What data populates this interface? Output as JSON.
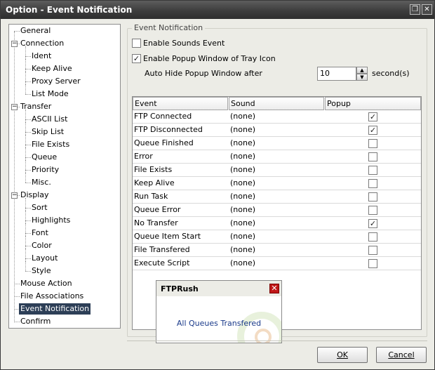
{
  "window": {
    "title": "Option - Event Notification"
  },
  "tree": [
    {
      "label": "General",
      "level": 0
    },
    {
      "label": "Connection",
      "level": 0,
      "expander": "−"
    },
    {
      "label": "Ident",
      "level": 1
    },
    {
      "label": "Keep Alive",
      "level": 1
    },
    {
      "label": "Proxy Server",
      "level": 1
    },
    {
      "label": "List Mode",
      "level": 1
    },
    {
      "label": "Transfer",
      "level": 0,
      "expander": "−"
    },
    {
      "label": "ASCII List",
      "level": 1
    },
    {
      "label": "Skip List",
      "level": 1
    },
    {
      "label": "File Exists",
      "level": 1
    },
    {
      "label": "Queue",
      "level": 1
    },
    {
      "label": "Priority",
      "level": 1
    },
    {
      "label": "Misc.",
      "level": 1
    },
    {
      "label": "Display",
      "level": 0,
      "expander": "−"
    },
    {
      "label": "Sort",
      "level": 1
    },
    {
      "label": "Highlights",
      "level": 1
    },
    {
      "label": "Font",
      "level": 1
    },
    {
      "label": "Color",
      "level": 1
    },
    {
      "label": "Layout",
      "level": 1
    },
    {
      "label": "Style",
      "level": 1
    },
    {
      "label": "Mouse Action",
      "level": 0
    },
    {
      "label": "File Associations",
      "level": 0
    },
    {
      "label": "Event Notification",
      "level": 0,
      "selected": true
    },
    {
      "label": "Confirm",
      "level": 0
    }
  ],
  "group": {
    "legend": "Event Notification"
  },
  "options": {
    "sounds": {
      "label": "Enable Sounds Event",
      "checked": false
    },
    "popup": {
      "label": "Enable Popup Window of Tray Icon",
      "checked": true
    },
    "autohide_label": "Auto Hide Popup Window after",
    "autohide_value": "10",
    "autohide_unit": "second(s)"
  },
  "table": {
    "columns": [
      "Event",
      "Sound",
      "Popup"
    ],
    "rows": [
      {
        "event": "FTP Connected",
        "sound": "(none)",
        "popup": true
      },
      {
        "event": "FTP Disconnected",
        "sound": "(none)",
        "popup": true
      },
      {
        "event": "Queue Finished",
        "sound": "(none)",
        "popup": false
      },
      {
        "event": "Error",
        "sound": "(none)",
        "popup": false
      },
      {
        "event": "File Exists",
        "sound": "(none)",
        "popup": false
      },
      {
        "event": "Keep Alive",
        "sound": "(none)",
        "popup": false
      },
      {
        "event": "Run Task",
        "sound": "(none)",
        "popup": false
      },
      {
        "event": "Queue Error",
        "sound": "(none)",
        "popup": false
      },
      {
        "event": "No Transfer",
        "sound": "(none)",
        "popup": true
      },
      {
        "event": "Queue Item Start",
        "sound": "(none)",
        "popup": false
      },
      {
        "event": "File Transfered",
        "sound": "(none)",
        "popup": false
      },
      {
        "event": "Execute Script",
        "sound": "(none)",
        "popup": false
      }
    ]
  },
  "popup_window": {
    "title": "FTPRush",
    "message": "All Queues Transfered"
  },
  "buttons": {
    "ok": "OK",
    "cancel": "Cancel"
  },
  "colors": {
    "selection": "#2d3f57",
    "titlebar": "#3d3d3d",
    "close": "#c01818",
    "message": "#1a3a8a"
  }
}
